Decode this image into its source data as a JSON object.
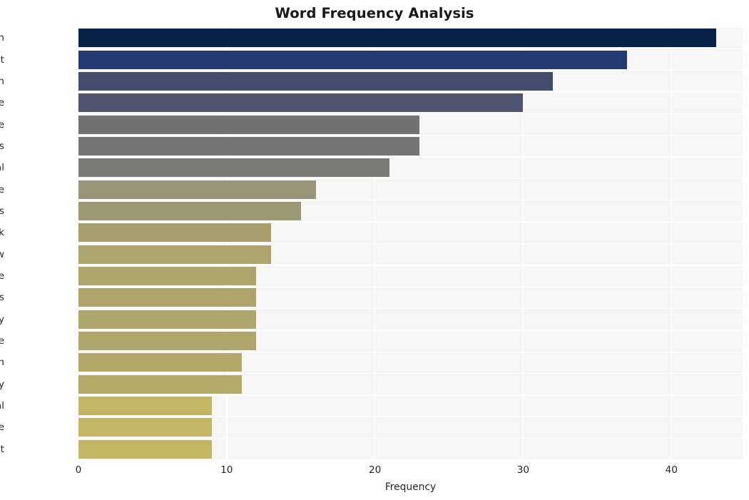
{
  "chart_data": {
    "type": "bar",
    "orientation": "horizontal",
    "title": "Word Frequency Analysis",
    "xlabel": "Frequency",
    "ylabel": "",
    "categories": [
      "convention",
      "right",
      "human",
      "article",
      "state",
      "activities",
      "national",
      "private",
      "systems",
      "framework",
      "law",
      "rule",
      "actors",
      "apply",
      "defence",
      "protection",
      "security",
      "artificial",
      "intelligence",
      "development"
    ],
    "values": [
      43,
      37,
      32,
      30,
      23,
      23,
      21,
      16,
      15,
      13,
      13,
      12,
      12,
      12,
      12,
      11,
      11,
      9,
      9,
      9
    ],
    "bar_colors": [
      "#062347",
      "#243a70",
      "#434c6c",
      "#4f5470",
      "#727272",
      "#757575",
      "#7a7a76",
      "#9a9478",
      "#9d9772",
      "#a89f6d",
      "#aca36d",
      "#ada46b",
      "#ada46b",
      "#afa66b",
      "#afa66b",
      "#b2a969",
      "#b4aa68",
      "#c2b565",
      "#c2b565",
      "#c3b665"
    ],
    "xlim": [
      0,
      44.8
    ],
    "xticks": [
      0,
      10,
      20,
      30,
      40
    ],
    "xtick_labels": [
      "0",
      "10",
      "20",
      "30",
      "40"
    ],
    "grid": true,
    "grid_color": "#ffffff",
    "plot_background": "#f6f6f7",
    "figure_background": "#ffffff",
    "legend": "none"
  }
}
